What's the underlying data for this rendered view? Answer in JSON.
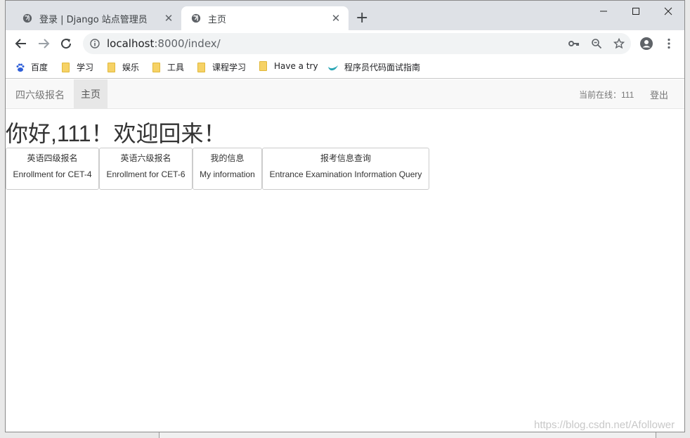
{
  "browser": {
    "tabs": [
      {
        "title": "登录 | Django 站点管理员",
        "active": false
      },
      {
        "title": "主页",
        "active": true
      }
    ],
    "address": {
      "host": "localhost",
      "path": ":8000/index/"
    },
    "bookmarks": [
      {
        "label": "百度",
        "icon": "baidu-paw-icon"
      },
      {
        "label": "学习",
        "icon": "folder-icon"
      },
      {
        "label": "娱乐",
        "icon": "folder-icon"
      },
      {
        "label": "工具",
        "icon": "folder-icon"
      },
      {
        "label": "课程学习",
        "icon": "folder-icon"
      },
      {
        "label": "Have a try",
        "icon": "folder-icon"
      },
      {
        "label": "程序员代码面试指南",
        "icon": "bird-icon"
      }
    ]
  },
  "navbar": {
    "brand": "四六级报名",
    "home": "主页",
    "online": "当前在线：111",
    "logout": "登出"
  },
  "greeting": "你好,111！欢迎回来！",
  "cards": [
    {
      "zh": "英语四级报名",
      "en": "Enrollment for CET-4"
    },
    {
      "zh": "英语六级报名",
      "en": "Enrollment for CET-6"
    },
    {
      "zh": "我的信息",
      "en": "My information"
    },
    {
      "zh": "报考信息查询",
      "en": "Entrance Examination Information Query"
    }
  ],
  "watermark": "https://blog.csdn.net/Afollower"
}
